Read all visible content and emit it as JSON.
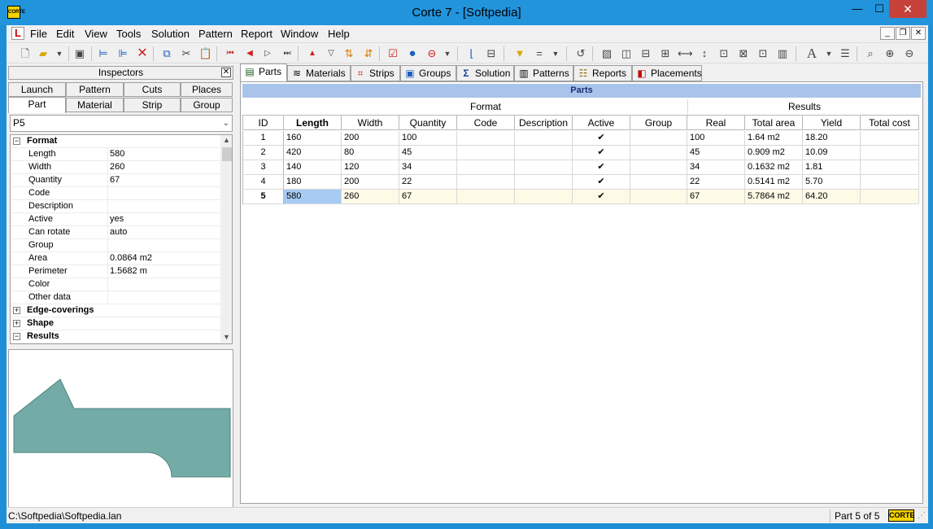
{
  "window": {
    "title": "Corte 7 - [Softpedia]",
    "app_icon_label": "CORTE",
    "minimize": "—",
    "maximize": "☐",
    "close": "✕"
  },
  "menu": {
    "items": [
      "File",
      "Edit",
      "View",
      "Tools",
      "Solution",
      "Pattern",
      "Report",
      "Window",
      "Help"
    ],
    "mdi_minimize": "_",
    "mdi_restore": "❐",
    "mdi_close": "✕"
  },
  "toolbar": {
    "icons": [
      "new-file-icon",
      "open-folder-icon",
      "dropdown-arrow-icon",
      "save-icon",
      "add-row-icon",
      "add-child-row-icon",
      "delete-icon",
      "copy-icon",
      "cut-icon",
      "paste-icon",
      "first-icon",
      "previous-icon",
      "next-icon",
      "last-icon",
      "move-up-icon",
      "move-down-icon",
      "sort-asc-icon",
      "sort-desc-icon",
      "validate-icon",
      "run-icon",
      "options-icon",
      "dropdown-arrow-icon",
      "pattern-icon",
      "cut-pattern-icon",
      "filter-icon",
      "equals-icon",
      "dropdown-arrow-icon",
      "reset-icon",
      "hatch-icon",
      "vsplit-icon",
      "hsplit-icon",
      "align-icon",
      "fit-width-icon",
      "fit-height-icon",
      "expand-icon",
      "collapse-icon",
      "frame-icon",
      "font-icon",
      "dropdown-arrow-icon",
      "list-icon",
      "zoom-fit-icon",
      "zoom-in-icon",
      "zoom-out-icon"
    ]
  },
  "inspector": {
    "title": "Inspectors",
    "close": "✕",
    "tabs_row1": [
      "Launch",
      "Pattern",
      "Cuts",
      "Places"
    ],
    "tabs_row2": [
      "Part",
      "Material",
      "Strip",
      "Group"
    ],
    "active_tab": "Part",
    "selected_part": "P5",
    "groups": [
      {
        "name": "Format",
        "expanded": true,
        "expander": "−",
        "props": [
          {
            "name": "Length",
            "value": "580"
          },
          {
            "name": "Width",
            "value": "260"
          },
          {
            "name": "Quantity",
            "value": "67"
          },
          {
            "name": "Code",
            "value": ""
          },
          {
            "name": "Description",
            "value": ""
          },
          {
            "name": "Active",
            "value": "yes"
          },
          {
            "name": "Can rotate",
            "value": "auto"
          },
          {
            "name": "Group",
            "value": ""
          },
          {
            "name": "Area",
            "value": "0.0864 m2"
          },
          {
            "name": "Perimeter",
            "value": "1.5682 m"
          },
          {
            "name": "Color",
            "value": ""
          },
          {
            "name": "Other data",
            "value": ""
          }
        ]
      },
      {
        "name": "Edge-coverings",
        "expanded": false,
        "expander": "+"
      },
      {
        "name": "Shape",
        "expanded": false,
        "expander": "+"
      },
      {
        "name": "Results",
        "expanded": true,
        "expander": "−"
      }
    ],
    "preview_color": "#73aba6"
  },
  "tabs": [
    {
      "label": "Parts",
      "icon": "parts-icon",
      "glyph": "▤",
      "active": true
    },
    {
      "label": "Materials",
      "icon": "materials-icon",
      "glyph": "≋",
      "active": false
    },
    {
      "label": "Strips",
      "icon": "strips-icon",
      "glyph": "⌗",
      "active": false
    },
    {
      "label": "Groups",
      "icon": "groups-icon",
      "glyph": "▣",
      "active": false
    },
    {
      "label": "Solution",
      "icon": "sigma-icon",
      "glyph": "Σ",
      "active": false
    },
    {
      "label": "Patterns",
      "icon": "patterns-icon",
      "glyph": "▥",
      "active": false
    },
    {
      "label": "Reports",
      "icon": "reports-icon",
      "glyph": "☷",
      "active": false
    },
    {
      "label": "Placements",
      "icon": "placements-icon",
      "glyph": "◧",
      "active": false
    }
  ],
  "grid": {
    "title": "Parts",
    "group_headers": {
      "format": "Format",
      "results": "Results"
    },
    "columns": [
      "ID",
      "Length",
      "Width",
      "Quantity",
      "Code",
      "Description",
      "Active",
      "Group",
      "Real",
      "Total area",
      "Yield",
      "Total cost"
    ],
    "rows": [
      {
        "id": "1",
        "length": "160",
        "width": "200",
        "quantity": "100",
        "code": "",
        "description": "",
        "active": "✔",
        "group": "",
        "real": "100",
        "total_area": "1.64 m2",
        "yield": "18.20",
        "total_cost": ""
      },
      {
        "id": "2",
        "length": "420",
        "width": "80",
        "quantity": "45",
        "code": "",
        "description": "",
        "active": "✔",
        "group": "",
        "real": "45",
        "total_area": "0.909 m2",
        "yield": "10.09",
        "total_cost": ""
      },
      {
        "id": "3",
        "length": "140",
        "width": "120",
        "quantity": "34",
        "code": "",
        "description": "",
        "active": "✔",
        "group": "",
        "real": "34",
        "total_area": "0.1632 m2",
        "yield": "1.81",
        "total_cost": ""
      },
      {
        "id": "4",
        "length": "180",
        "width": "200",
        "quantity": "22",
        "code": "",
        "description": "",
        "active": "✔",
        "group": "",
        "real": "22",
        "total_area": "0.5141 m2",
        "yield": "5.70",
        "total_cost": ""
      },
      {
        "id": "5",
        "length": "580",
        "width": "260",
        "quantity": "67",
        "code": "",
        "description": "",
        "active": "✔",
        "group": "",
        "real": "67",
        "total_area": "5.7864 m2",
        "yield": "64.20",
        "total_cost": ""
      }
    ],
    "selected_row": 4
  },
  "status": {
    "path": "C:\\Softpedia\\Softpedia.lan",
    "position": "Part 5 of 5",
    "logo": "CORTE"
  }
}
